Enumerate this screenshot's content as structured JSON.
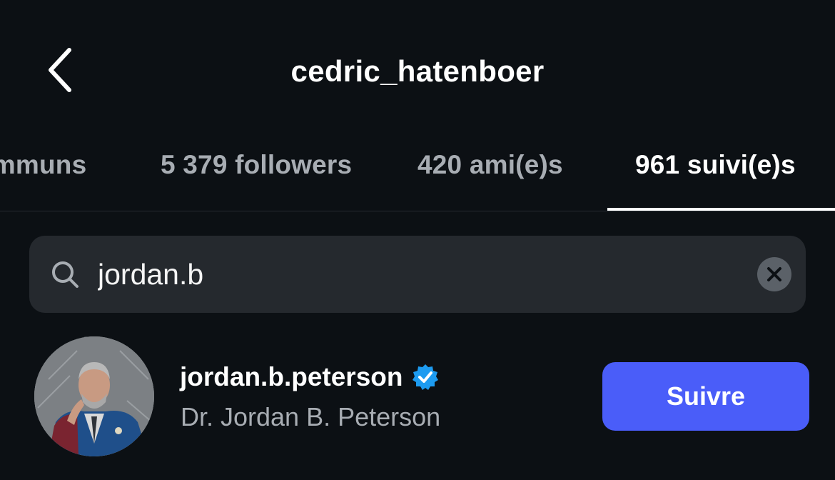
{
  "header": {
    "title": "cedric_hatenboer",
    "back_icon": "chevron-left-icon"
  },
  "tabs": [
    {
      "label": "ommuns",
      "active": false
    },
    {
      "label": "5 379 followers",
      "active": false
    },
    {
      "label": "420 ami(e)s",
      "active": false
    },
    {
      "label": "961 suivi(e)s",
      "active": true
    }
  ],
  "search": {
    "value": "jordan.b",
    "placeholder": "",
    "icon": "search-icon",
    "clear_icon": "clear-icon"
  },
  "results": [
    {
      "username": "jordan.b.peterson",
      "verified": true,
      "full_name": "Dr. Jordan B. Peterson",
      "follow_label": "Suivre"
    }
  ],
  "colors": {
    "background": "#0c1014",
    "tab_inactive": "#a8adb3",
    "search_bg": "#25292e",
    "button_blue": "#4a5df9",
    "verified_blue": "#1d9bf0"
  }
}
